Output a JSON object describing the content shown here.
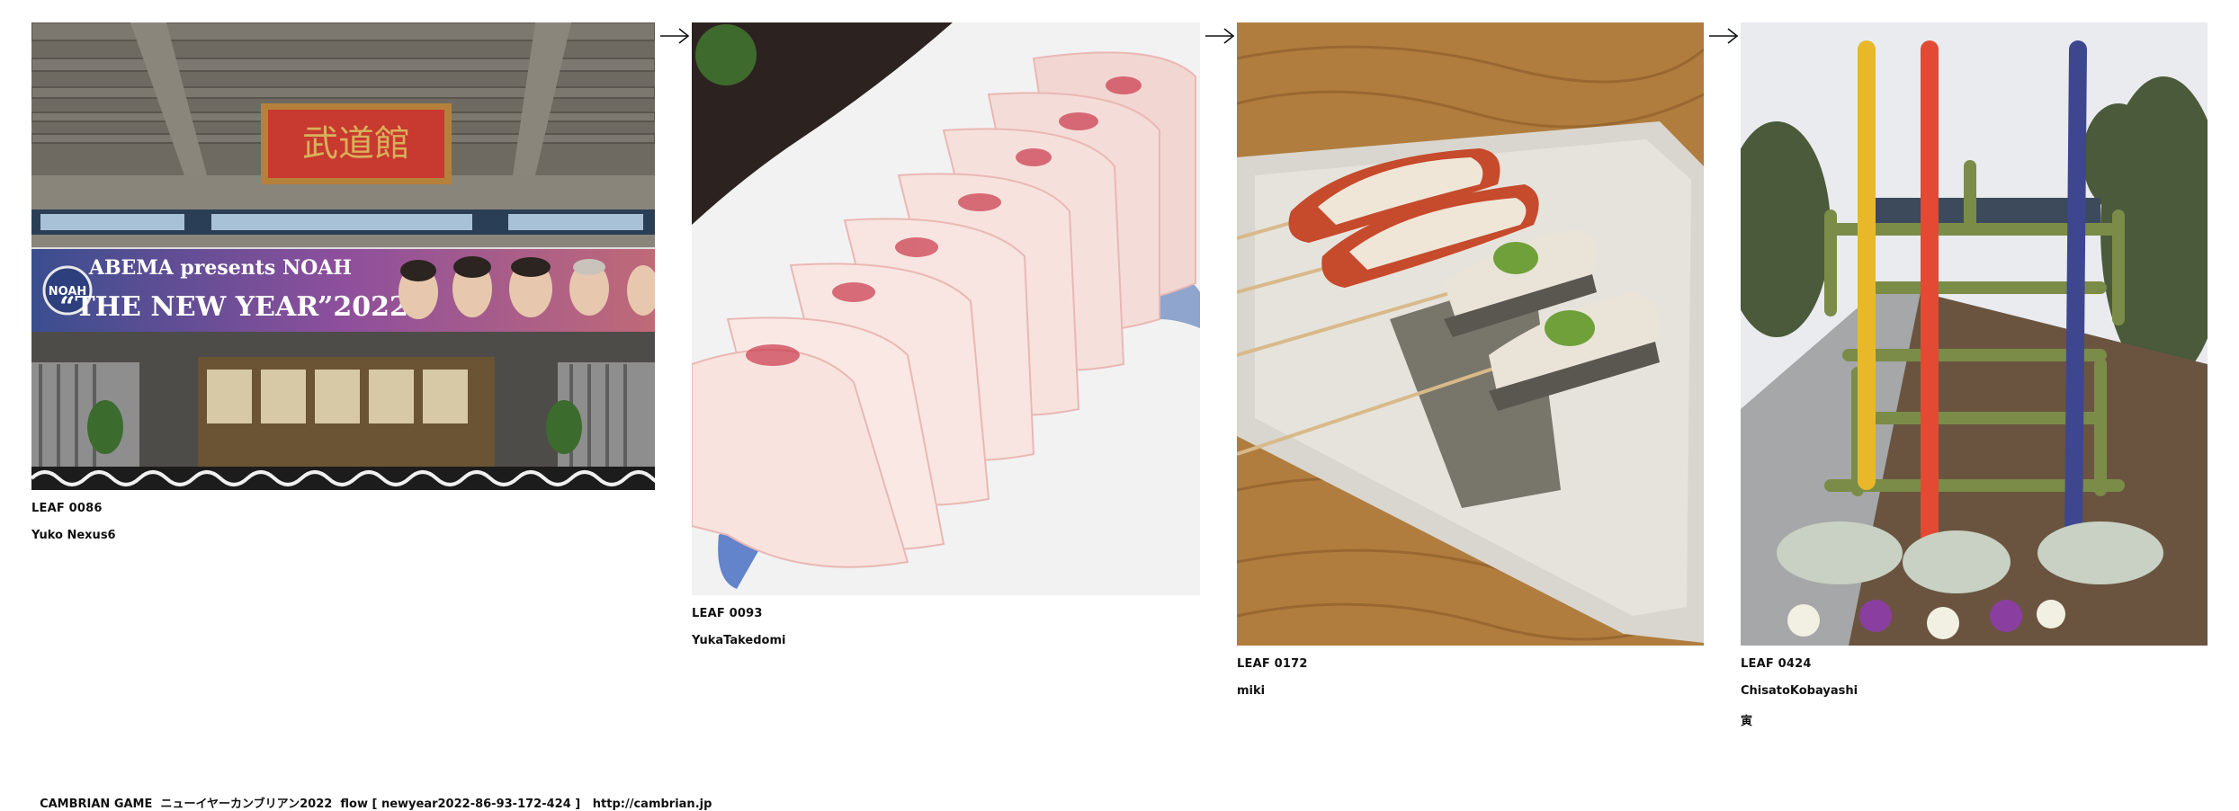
{
  "leaves": [
    {
      "id_label": "LEAF 0086",
      "author": "Yuko Nexus6",
      "photo_subject": "budokan-entrance",
      "sign_text": "武道館",
      "banner_line1": "ABEMA presents NOAH",
      "banner_line2": "“THE NEW YEAR”2022",
      "banner_logo": "NOAH"
    },
    {
      "id_label": "LEAF 0093",
      "author": "YukaTakedomi",
      "photo_subject": "sashimi-plate"
    },
    {
      "id_label": "LEAF 0172",
      "author": "miki",
      "photo_subject": "grilled-skewers-plate"
    },
    {
      "id_label": "LEAF 0424",
      "author": "ChisatoKobayashi",
      "note": "寅",
      "photo_subject": "bamboo-kanji-sculpture"
    }
  ],
  "arrow_icon": "right-arrow-icon",
  "footer": {
    "brand": "CAMBRIAN GAME",
    "title": "ニューイヤーカンブリアン2022",
    "flow": "flow [ newyear2022-86-93-172-424 ]",
    "url": "http://cambrian.jp"
  }
}
